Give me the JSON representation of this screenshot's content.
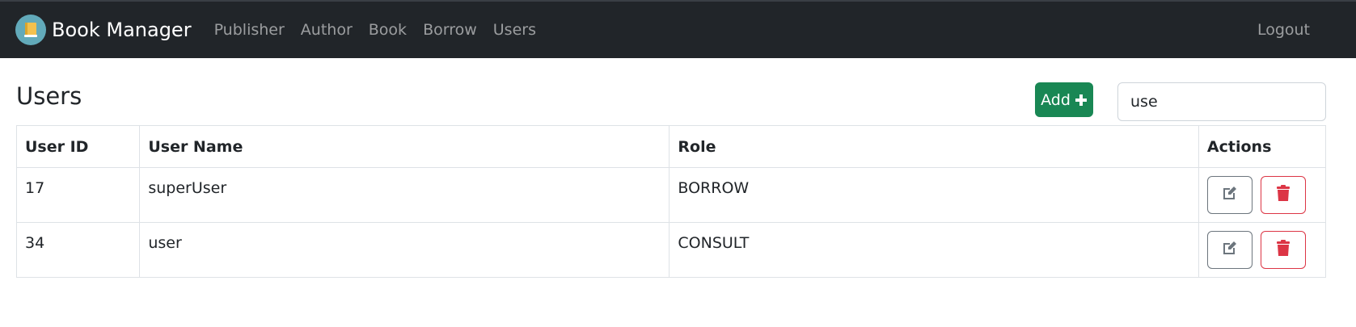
{
  "app": {
    "title": "Book Manager",
    "logo_icon": "book-icon"
  },
  "nav": {
    "items": [
      {
        "label": "Publisher"
      },
      {
        "label": "Author"
      },
      {
        "label": "Book"
      },
      {
        "label": "Borrow"
      },
      {
        "label": "Users"
      }
    ],
    "logout_label": "Logout"
  },
  "page": {
    "title": "Users",
    "add_label": "Add",
    "search_value": "use"
  },
  "table": {
    "headers": {
      "id": "User ID",
      "name": "User Name",
      "role": "Role",
      "actions": "Actions"
    },
    "rows": [
      {
        "id": "17",
        "name": "superUser",
        "role": "BORROW"
      },
      {
        "id": "34",
        "name": "user",
        "role": "CONSULT"
      }
    ]
  },
  "colors": {
    "navbar_bg": "#212529",
    "add_button": "#198754",
    "delete": "#dc3545",
    "edit": "#6c757d"
  },
  "icons": {
    "add": "plus-icon",
    "edit": "edit-icon",
    "delete": "trash-icon"
  }
}
